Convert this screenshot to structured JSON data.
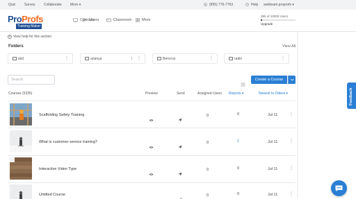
{
  "topbar": {
    "items": [
      "Quiz",
      "Survey",
      "Collaborate",
      "More ▾"
    ],
    "phone": "(855) 776-7763",
    "help": "Help",
    "account": "webteam.proprofs ▾"
  },
  "logo": {
    "word_a": "Pro",
    "word_b": "Profs",
    "sub": "Training Maker"
  },
  "nav": [
    {
      "label": "Courses",
      "icon": "courses-icon"
    },
    {
      "label": "Users",
      "icon": "users-icon"
    },
    {
      "label": "Classroom",
      "icon": "classroom-icon"
    },
    {
      "label": "More",
      "icon": "more-grid-icon"
    }
  ],
  "usage": {
    "text": "390 of 10000 Users",
    "fraction": 0.039,
    "upgrade": "Upgrade"
  },
  "help_line": "View help for this section",
  "folders": {
    "title": "Folders",
    "view_all": "View All",
    "items": [
      {
        "name": "dsd",
        "count": ""
      },
      {
        "name": "ananya",
        "count": "1"
      },
      {
        "name": "Bencrus",
        "count": ""
      },
      {
        "name": "radio",
        "count": ""
      }
    ]
  },
  "search": {
    "placeholder": "Search"
  },
  "create_button": "Create a Course",
  "table": {
    "headers": {
      "courses": "Courses (5335)",
      "preview": "Preview",
      "send": "Send",
      "assigned": "Assigned Users",
      "reports": "Reports ▾",
      "sort": "Newest to Oldest ▾"
    },
    "rows": [
      {
        "title": "Scaffolding Safety Training",
        "users": "0",
        "reports": "0",
        "date": "Jul 11"
      },
      {
        "title": "What is customer service training?",
        "users": "0",
        "reports": "1",
        "date": "Jul 11"
      },
      {
        "title": "Interactive Video Type",
        "users": "0",
        "reports": "0",
        "date": "Jul 11"
      },
      {
        "title": "Untitled Course",
        "users": "0",
        "reports": "0",
        "date": "Jul 11"
      }
    ]
  },
  "feedback": "Feedback",
  "colors": {
    "accent": "#2a7fd4",
    "brand_blue": "#1f4f93",
    "brand_orange": "#f26a21"
  }
}
